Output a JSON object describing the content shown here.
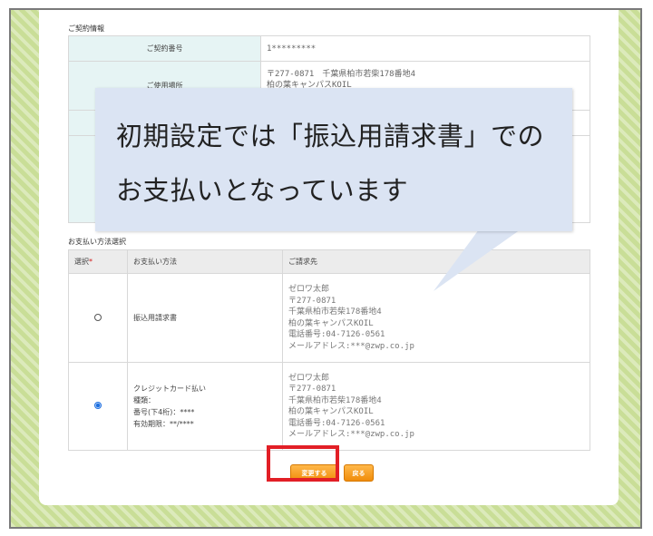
{
  "contract": {
    "section_label": "ご契約情報",
    "rows": [
      {
        "label": "ご契約番号",
        "value_lines": [
          "1*********"
        ]
      },
      {
        "label": "ご使用場所",
        "value_lines": [
          "〒277-0871　千葉県柏市若柴178番地4",
          "柏の葉キャンパスKOIL"
        ]
      }
    ]
  },
  "payment": {
    "section_label": "お支払い方法選択",
    "headers": {
      "select": "選択",
      "required_mark": "*",
      "method": "お支払い方法",
      "billing": "ご請求先"
    },
    "options": [
      {
        "selected": false,
        "method_lines": [
          "振込用請求書"
        ],
        "billing_lines": [
          "ゼロワ太郎",
          "〒277-0871",
          "千葉県柏市若柴178番地4",
          "柏の葉キャンパスKOIL",
          "電話番号:04-7126-0561",
          "メールアドレス:***@zwp.co.jp"
        ]
      },
      {
        "selected": true,
        "method_lines": [
          "クレジットカード払い",
          "種類：",
          "番号(下4桁)：****",
          "有効期限：**/****"
        ],
        "billing_lines": [
          "ゼロワ太郎",
          "〒277-0871",
          "千葉県柏市若柴178番地4",
          "柏の葉キャンパスKOIL",
          "電話番号:04-7126-0561",
          "メールアドレス:***@zwp.co.jp"
        ]
      }
    ]
  },
  "buttons": {
    "change": "変更する",
    "back": "戻る"
  },
  "callout": {
    "line1": "初期設定では「振込用請求書」での",
    "line2": "お支払いとなっています"
  },
  "colors": {
    "accent": "#f08c0a",
    "highlight": "#e21f26",
    "callout_bg": "#dbe4f3",
    "background": "#c9de97",
    "header_cell": "#e6f4f4"
  }
}
